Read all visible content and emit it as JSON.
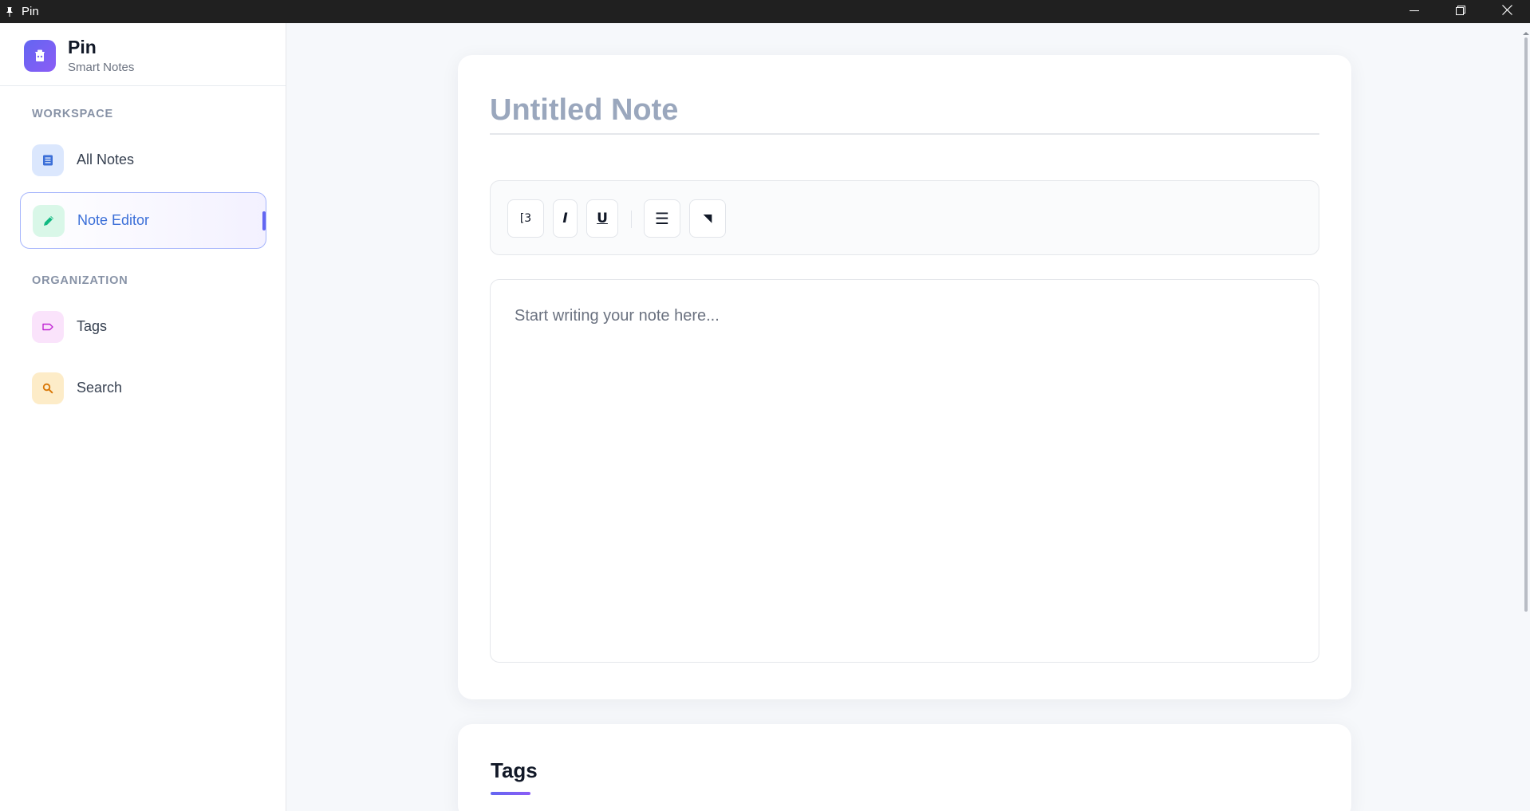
{
  "window": {
    "title": "Pin",
    "icons": [
      "pin-icon",
      "minimize-icon",
      "restore-icon",
      "close-icon"
    ]
  },
  "sidebar": {
    "brand": {
      "name": "Pin",
      "subtitle": "Smart Notes",
      "icon": "app-logo-icon"
    },
    "sections": [
      {
        "label": "WORKSPACE",
        "items": [
          {
            "label": "All Notes",
            "icon": "notes-list-icon",
            "active": false,
            "color": "#3b6fd8"
          },
          {
            "label": "Note Editor",
            "icon": "pencil-icon",
            "active": true,
            "color": "#10b981"
          }
        ]
      },
      {
        "label": "ORGANIZATION",
        "items": [
          {
            "label": "Tags",
            "icon": "tag-icon",
            "active": false,
            "color": "#c026d3"
          },
          {
            "label": "Search",
            "icon": "search-icon",
            "active": false,
            "color": "#d97706"
          }
        ]
      }
    ]
  },
  "editor": {
    "title_placeholder": "Untitled Note",
    "title_value": "",
    "body_placeholder": "Start writing your note here...",
    "body_value": "",
    "toolbar": {
      "buttons": [
        {
          "label": "[3",
          "icon": "bold-icon"
        },
        {
          "label": "I",
          "icon": "italic-icon"
        },
        {
          "label": "U",
          "icon": "underline-icon"
        },
        {
          "label": "☰",
          "icon": "list-icon"
        },
        {
          "label": "◥",
          "icon": "highlight-icon"
        }
      ]
    }
  },
  "tags_panel": {
    "title": "Tags"
  },
  "colors": {
    "accent": "#6366f1",
    "active_text": "#3b6fd8",
    "sidebar_bg": "#ffffff",
    "page_bg": "#f6f8fb"
  }
}
